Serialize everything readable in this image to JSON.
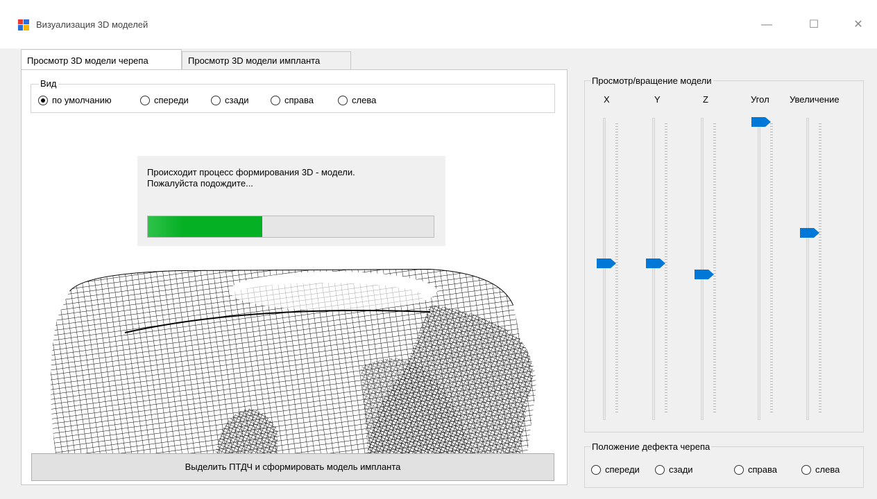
{
  "window": {
    "title": "Визуализация 3D моделей",
    "minimize_glyph": "—",
    "maximize_glyph": "☐",
    "close_glyph": "✕"
  },
  "tabs": [
    {
      "label": "Просмотр 3D модели черепа",
      "active": true
    },
    {
      "label": "Просмотр 3D модели импланта",
      "active": false
    }
  ],
  "view": {
    "legend": "Вид",
    "options": [
      "по умолчанию",
      "спереди",
      "сзади",
      "справа",
      "слева"
    ],
    "selected": "по умолчанию"
  },
  "progress": {
    "message_line1": "Происходит процесс формирования 3D - модели.",
    "message_line2": "Пожалуйста подождите...",
    "value_fraction": 0.4
  },
  "main_button_label": "Выделить ПТДЧ и сформировать модель импланта",
  "rotation": {
    "legend": "Просмотр/вращение модели",
    "sliders": [
      {
        "label": "X",
        "level": 0.49
      },
      {
        "label": "Y",
        "level": 0.49
      },
      {
        "label": "Z",
        "level": 0.45
      },
      {
        "label": "Угол",
        "level": 1.0
      },
      {
        "label": "Увеличение",
        "level": 0.6
      }
    ]
  },
  "defect": {
    "legend": "Положение дефекта черепа",
    "options": [
      "спереди",
      "сзади",
      "справа",
      "слева"
    ]
  },
  "colors": {
    "accent": "#0078d7",
    "progress": "#06b025"
  },
  "icons": {
    "app": "app-window-icon"
  }
}
